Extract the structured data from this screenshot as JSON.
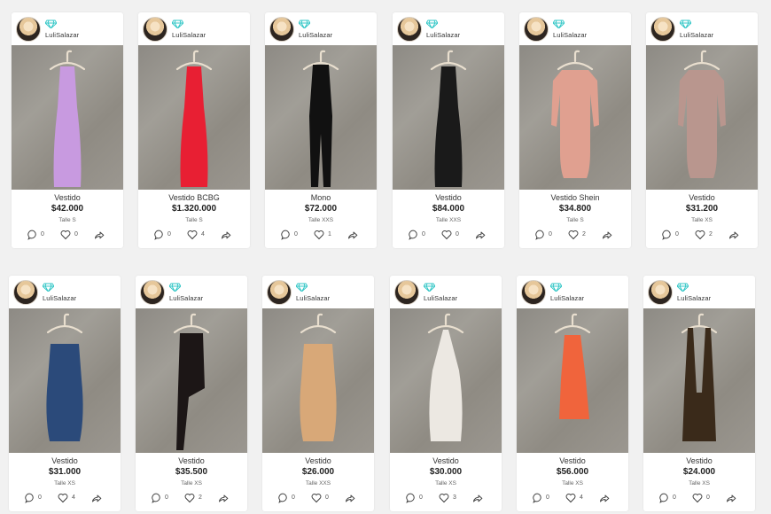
{
  "listings": [
    {
      "user": "LuliSalazar",
      "title": "Vestido",
      "price": "$42.000",
      "size": "Talle S",
      "comments": "0",
      "likes": "0",
      "garment_color": "#c89ae0",
      "shape": "long"
    },
    {
      "user": "LuliSalazar",
      "title": "Vestido BCBG",
      "price": "$1.320.000",
      "size": "Talle S",
      "comments": "0",
      "likes": "4",
      "garment_color": "#e81f33",
      "shape": "long"
    },
    {
      "user": "LuliSalazar",
      "title": "Mono",
      "price": "$72.000",
      "size": "Talle XXS",
      "comments": "0",
      "likes": "1",
      "garment_color": "#111111",
      "shape": "jumpsuit"
    },
    {
      "user": "LuliSalazar",
      "title": "Vestido",
      "price": "$84.000",
      "size": "Talle XXS",
      "comments": "0",
      "likes": "0",
      "garment_color": "#1a1a1a",
      "shape": "long"
    },
    {
      "user": "LuliSalazar",
      "title": "Vestido Shein",
      "price": "$34.800",
      "size": "Talle S",
      "comments": "0",
      "likes": "2",
      "garment_color": "#e0a090",
      "shape": "sleeved"
    },
    {
      "user": "LuliSalazar",
      "title": "Vestido",
      "price": "$31.200",
      "size": "Talle XS",
      "comments": "0",
      "likes": "2",
      "garment_color": "#b9968e",
      "shape": "sleeved"
    },
    {
      "user": "LuliSalazar",
      "title": "Vestido",
      "price": "$31.000",
      "size": "Talle XS",
      "comments": "0",
      "likes": "4",
      "garment_color": "#2b4a7a",
      "shape": "short"
    },
    {
      "user": "LuliSalazar",
      "title": "Vestido",
      "price": "$35.500",
      "size": "Talle XS",
      "comments": "0",
      "likes": "2",
      "garment_color": "#1c1616",
      "shape": "asym"
    },
    {
      "user": "LuliSalazar",
      "title": "Vestido",
      "price": "$26.000",
      "size": "Talle XXS",
      "comments": "0",
      "likes": "0",
      "garment_color": "#d8a878",
      "shape": "short"
    },
    {
      "user": "LuliSalazar",
      "title": "Vestido",
      "price": "$30.000",
      "size": "Talle XS",
      "comments": "0",
      "likes": "3",
      "garment_color": "#ece8e2",
      "shape": "halter"
    },
    {
      "user": "LuliSalazar",
      "title": "Vestido",
      "price": "$56.000",
      "size": "Talle XS",
      "comments": "0",
      "likes": "4",
      "garment_color": "#f0643c",
      "shape": "mid"
    },
    {
      "user": "LuliSalazar",
      "title": "Vestido",
      "price": "$24.000",
      "size": "Talle XS",
      "comments": "0",
      "likes": "0",
      "garment_color": "#3a2a1a",
      "shape": "overall"
    }
  ],
  "icons": {
    "badge": "diamond-icon",
    "comment": "comment-icon",
    "like": "heart-icon",
    "share": "share-icon"
  },
  "colors": {
    "badge": "#34c7c7",
    "hanger": "#e9dfcf"
  }
}
